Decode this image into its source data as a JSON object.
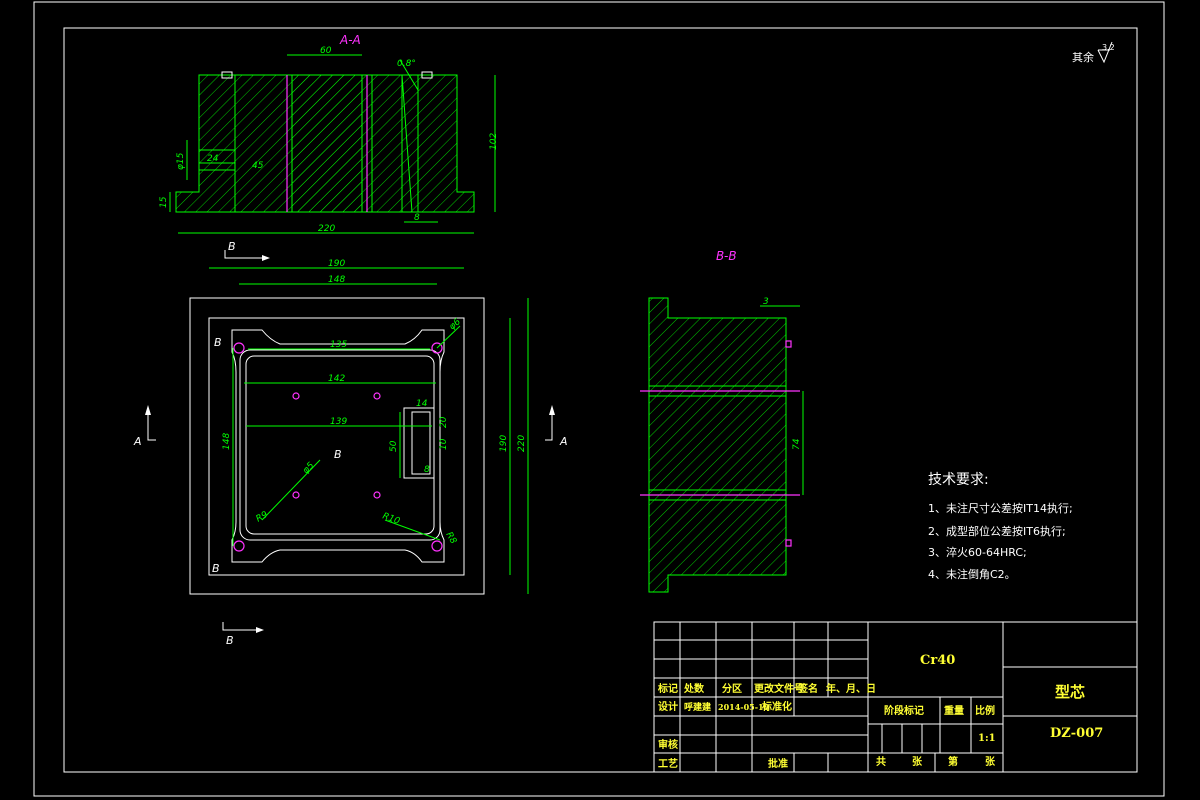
{
  "views": {
    "section_aa_label": "A-A",
    "section_bb_label": "B-B",
    "view_a_label": "A",
    "view_b_label": "B"
  },
  "surface_finish": {
    "label": "其余",
    "value": "3.2"
  },
  "dimensions": {
    "aa": {
      "top_width": "60",
      "angle": "0.8°",
      "d_small": "φ15",
      "depth_24": "24",
      "h_45": "45",
      "h_15": "15",
      "h_102": "102",
      "w_220": "220",
      "w_8": "8",
      "r_15": "15"
    },
    "plan": {
      "w_190": "190",
      "w_148": "148",
      "w_135": "135",
      "w_142": "142",
      "w_139": "139",
      "h_148": "148",
      "h_190": "190",
      "h_220": "220",
      "h_50": "50",
      "h_20": "20",
      "h_10": "10",
      "w_14": "14",
      "w_8": "8",
      "hole_phi6": "φ6",
      "hole_phi5": "φ5",
      "r9": "R9",
      "r10": "R10",
      "r8": "R8"
    },
    "bb": {
      "w_3": "3",
      "h_74": "74"
    }
  },
  "technical_requirements": {
    "title": "技术要求:",
    "items": [
      "1、未注尺寸公差按IT14执行;",
      "2、成型部位公差按IT6执行;",
      "3、淬火60-64HRC;",
      "4、未注倒角C2。"
    ]
  },
  "title_block": {
    "material": "Cr40",
    "part_name": "型芯",
    "drawing_no": "DZ-007",
    "rev_headers": [
      "标记",
      "处数",
      "分区",
      "更改文件号",
      "签名",
      "年、月、日"
    ],
    "row_design": [
      "设计",
      "呼建建",
      "2014-05-10",
      "标准化"
    ],
    "row_review": "审核",
    "row_process": "工艺",
    "approve": "批准",
    "stage_mark": "阶段标记",
    "weight": "重量",
    "scale_label": "比例",
    "scale_value": "1:1",
    "sheet_total": "共",
    "sheet_unit": "张",
    "sheet_no": "第",
    "sheet_unit2": "张"
  },
  "colors": {
    "background": "#000000",
    "lines": "#00ff00",
    "outline": "#ffffff",
    "section_marks": "#ff33ff",
    "title_text": "#ffff33"
  }
}
